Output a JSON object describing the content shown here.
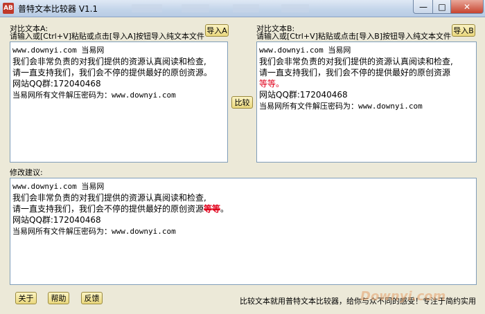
{
  "window": {
    "app_icon_text": "AB",
    "title": "普特文本比较器 V1.1",
    "controls": {
      "minimize": "—",
      "maximize": "□",
      "close": "✕"
    }
  },
  "panel_a": {
    "header": "对比文本A:",
    "hint": "请输入或[Ctrl+V]粘贴或点击[导入A]按钮导入纯文本文件",
    "import_label": "导入A",
    "lines": [
      "www.downyi.com 当易网",
      "我们会非常负责的对我们提供的资源认真阅读和检查,",
      "请一直支持我们，我们会不停的提供最好的原创资源。",
      "网站QQ群:172040468",
      "当易网所有文件解压密码为：www.downyi.com"
    ]
  },
  "compare_label": "比较",
  "panel_b": {
    "header": "对比文本B:",
    "hint": "请输入或[Ctrl+V]粘贴或点击[导入B]按钮导入纯文本文件",
    "import_label": "导入B",
    "lines": [
      "www.downyi.com 当易网",
      "我们会非常负责的对我们提供的资源认真阅读和检查,",
      "请一直支持我们，我们会不停的提供最好的原创资源",
      "等等。",
      "网站QQ群:172040468",
      "当易网所有文件解压密码为：www.downyi.com"
    ]
  },
  "suggestions": {
    "header": "修改建议:",
    "lines": [
      "www.downyi.com 当易网",
      "我们会非常负责的对我们提供的资源认真阅读和检查,",
      "请一直支持我们，我们会不停的提供最好的原创资源",
      "网站QQ群:172040468",
      "当易网所有文件解压密码为：www.downyi.com"
    ],
    "diff_text": "等等",
    "diff_tail": "。"
  },
  "bottom_buttons": {
    "about": "关于",
    "help": "帮助",
    "feedback": "反馈"
  },
  "footer_text": "比较文本就用普特文本比较器，给你与众不同的感受！专注于简约实用",
  "watermark": "Downyi.com"
}
